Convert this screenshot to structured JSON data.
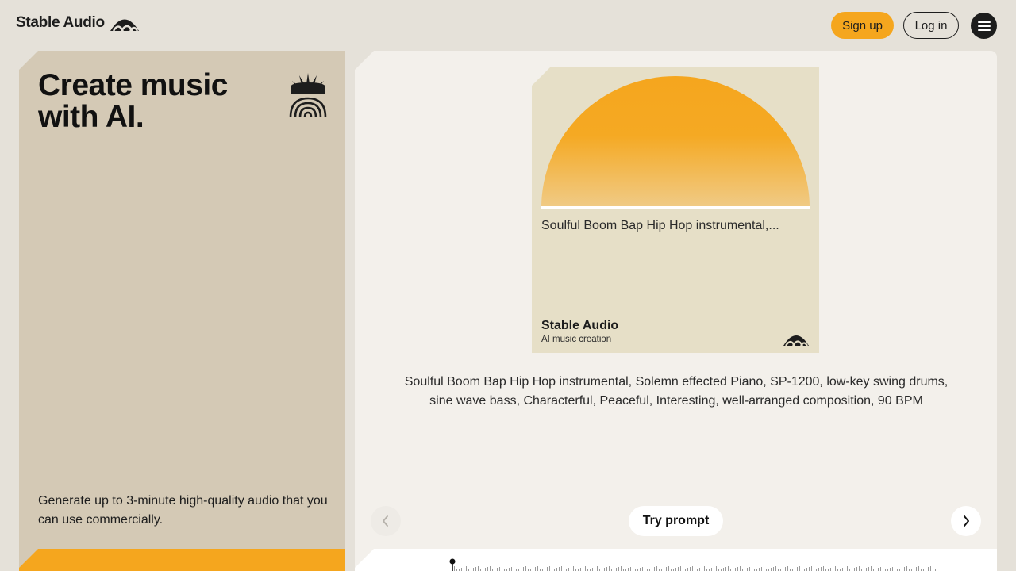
{
  "header": {
    "brand": "Stable Audio",
    "brand_icon": "stable-audio-logo",
    "signup_label": "Sign up",
    "login_label": "Log in",
    "menu_icon": "hamburger-menu-icon"
  },
  "hero": {
    "title": "Create music with AI.",
    "description": "Generate up to 3-minute high-quality audio that you can use commercially.",
    "icon": "sunrise-rainbow-icon"
  },
  "showcase": {
    "cover_title": "Soulful Boom Bap Hip Hop instrumental,...",
    "cover_brand": "Stable Audio",
    "cover_subtitle": "AI music creation",
    "prompt": "Soulful Boom Bap Hip Hop instrumental, Solemn effected Piano, SP-1200, low-key swing drums, sine wave bass, Characterful, Peaceful, Interesting, well-arranged composition, 90 BPM",
    "try_label": "Try prompt",
    "prev_icon": "chevron-left-icon",
    "next_icon": "chevron-right-icon"
  },
  "colors": {
    "accent": "#f5a61e",
    "page_bg": "#e5e1d9",
    "left_panel": "#d4c9b5",
    "right_panel": "#f3f0eb",
    "card_bg": "#e6dfc7",
    "text": "#1d1d1d"
  }
}
